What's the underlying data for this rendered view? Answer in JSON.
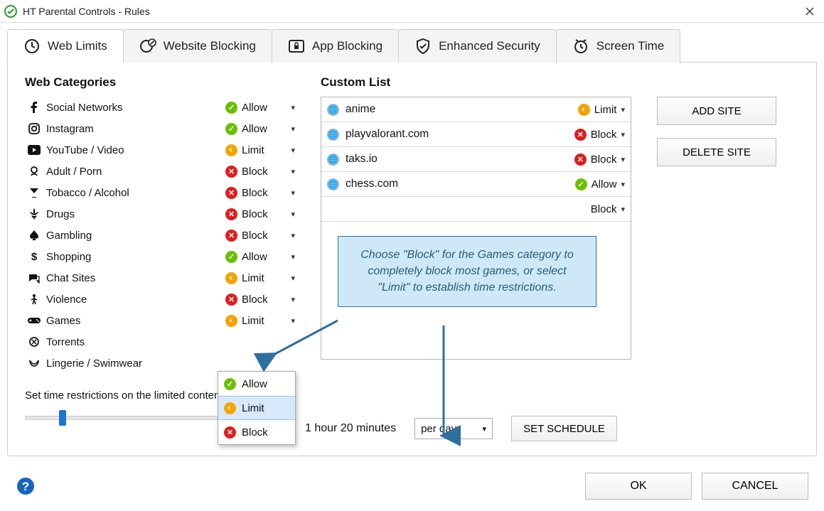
{
  "window": {
    "title": "HT Parental Controls - Rules"
  },
  "tabs": [
    {
      "label": "Web Limits",
      "active": true
    },
    {
      "label": "Website Blocking"
    },
    {
      "label": "App Blocking"
    },
    {
      "label": "Enhanced Security"
    },
    {
      "label": "Screen Time"
    }
  ],
  "sections": {
    "web_categories": "Web Categories",
    "custom_list": "Custom List"
  },
  "categories": [
    {
      "name": "Social Networks",
      "rule": "Allow"
    },
    {
      "name": "Instagram",
      "rule": "Allow"
    },
    {
      "name": "YouTube / Video",
      "rule": "Limit"
    },
    {
      "name": "Adult / Porn",
      "rule": "Block"
    },
    {
      "name": "Tobacco / Alcohol",
      "rule": "Block"
    },
    {
      "name": "Drugs",
      "rule": "Block"
    },
    {
      "name": "Gambling",
      "rule": "Block"
    },
    {
      "name": "Shopping",
      "rule": "Allow"
    },
    {
      "name": "Chat Sites",
      "rule": "Limit"
    },
    {
      "name": "Violence",
      "rule": "Block"
    },
    {
      "name": "Games",
      "rule": "Limit"
    },
    {
      "name": "Torrents",
      "rule": ""
    },
    {
      "name": "Lingerie / Swimwear",
      "rule": ""
    }
  ],
  "dropdown_options": [
    {
      "label": "Allow",
      "type": "allow"
    },
    {
      "label": "Limit",
      "type": "limit"
    },
    {
      "label": "Block",
      "type": "block"
    }
  ],
  "custom_sites": [
    {
      "site": "anime",
      "rule": "Limit"
    },
    {
      "site": "playvalorant.com",
      "rule": "Block"
    },
    {
      "site": "taks.io",
      "rule": "Block"
    },
    {
      "site": "chess.com",
      "rule": "Allow"
    },
    {
      "site": "",
      "rule": "Block"
    }
  ],
  "buttons": {
    "add_site": "ADD SITE",
    "delete_site": "DELETE SITE",
    "set_schedule": "SET SCHEDULE",
    "ok": "OK",
    "cancel": "CANCEL"
  },
  "restriction": {
    "label": "Set time restrictions on the limited content:",
    "value_text": "1 hour 20 minutes",
    "period": "per day"
  },
  "callout": {
    "text": "Choose \"Block\" for the Games category to completely block most games, or select \"Limit\" to establish time restrictions."
  }
}
